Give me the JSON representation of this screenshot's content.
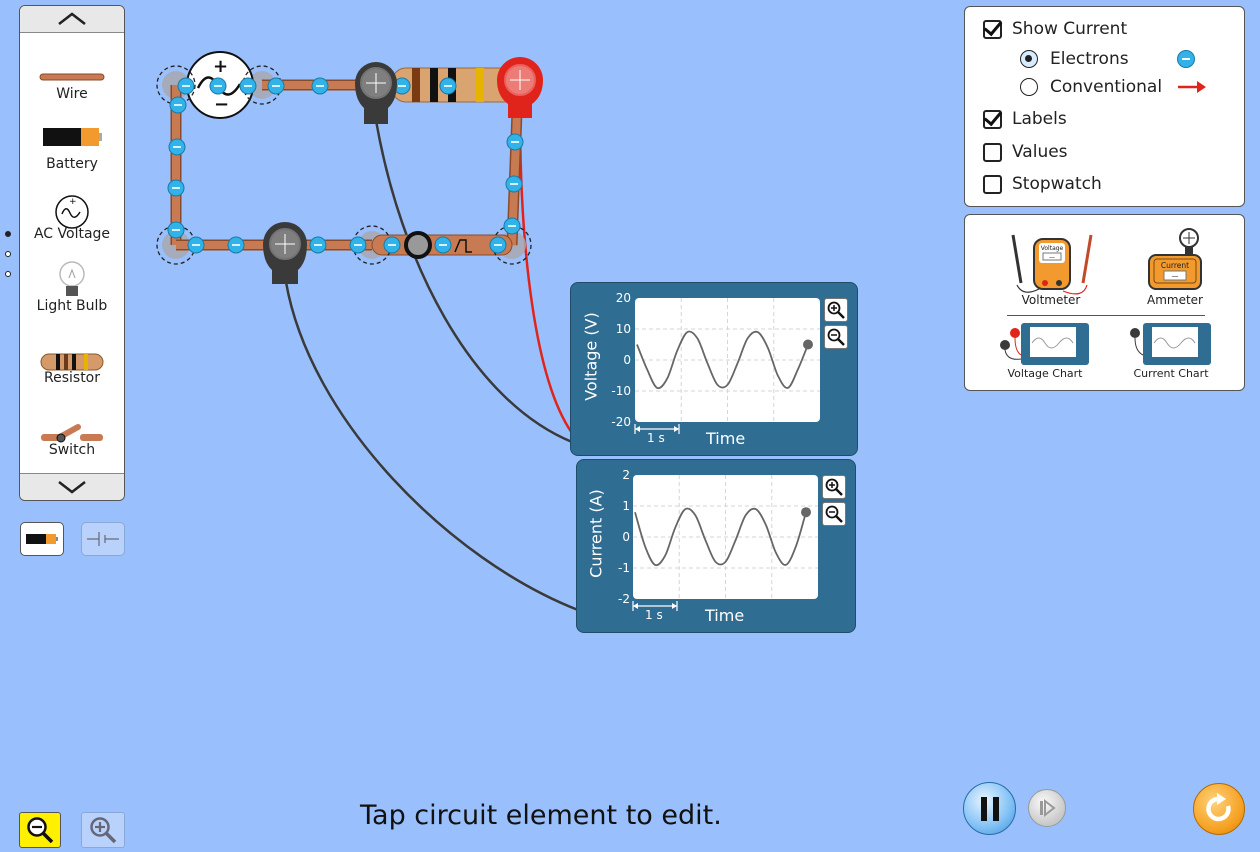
{
  "toolbox": {
    "items": [
      {
        "label": "Wire",
        "icon": "wire-icon"
      },
      {
        "label": "Battery",
        "icon": "battery-icon"
      },
      {
        "label": "AC Voltage",
        "icon": "ac-voltage-icon"
      },
      {
        "label": "Light Bulb",
        "icon": "light-bulb-icon"
      },
      {
        "label": "Resistor",
        "icon": "resistor-icon"
      },
      {
        "label": "Switch",
        "icon": "switch-icon"
      }
    ],
    "page": 1,
    "page_count": 3
  },
  "controls": {
    "show_current": {
      "label": "Show Current",
      "checked": true
    },
    "electrons": {
      "label": "Electrons",
      "selected": true
    },
    "conventional": {
      "label": "Conventional",
      "selected": false
    },
    "labels": {
      "label": "Labels",
      "checked": true
    },
    "values": {
      "label": "Values",
      "checked": false
    },
    "stopwatch": {
      "label": "Stopwatch",
      "checked": false
    }
  },
  "sensors": {
    "voltmeter": "Voltmeter",
    "ammeter": "Ammeter",
    "voltage_chart": "Voltage Chart",
    "current_chart": "Current Chart",
    "voltmeter_badge": "Voltage",
    "ammeter_badge": "Current",
    "meter_dash": "—"
  },
  "voltage_chart": {
    "y_title": "Voltage (V)",
    "x_title": "Time",
    "scale_label": "1 s",
    "ticks": [
      "20",
      "10",
      "0",
      "-10",
      "-20"
    ]
  },
  "current_chart": {
    "y_title": "Current (A)",
    "x_title": "Time",
    "scale_label": "1 s",
    "ticks": [
      "2",
      "1",
      "0",
      "-1",
      "-2"
    ]
  },
  "chart_data": [
    {
      "type": "line",
      "ylabel": "Voltage (V)",
      "xlabel": "Time",
      "ylim": [
        -20,
        20
      ],
      "x": [
        0.0,
        0.25,
        0.5,
        0.75,
        1.0,
        1.25,
        1.5,
        1.75,
        2.0,
        2.25,
        2.5,
        2.75,
        3.0,
        3.25,
        3.5,
        3.75,
        4.0,
        4.25
      ],
      "series": [
        {
          "values": [
            5,
            -3,
            -9,
            -6,
            3,
            9,
            7,
            -1,
            -8,
            -8,
            -1,
            7,
            9,
            4,
            -5,
            -9,
            -3,
            5
          ]
        }
      ]
    },
    {
      "type": "line",
      "ylabel": "Current (A)",
      "xlabel": "Time",
      "ylim": [
        -2,
        2
      ],
      "x": [
        0.0,
        0.25,
        0.5,
        0.75,
        1.0,
        1.25,
        1.5,
        1.75,
        2.0,
        2.25,
        2.5,
        2.75,
        3.0,
        3.25,
        3.5,
        3.75,
        4.0,
        4.25
      ],
      "series": [
        {
          "values": [
            0.8,
            -0.3,
            -0.9,
            -0.6,
            0.3,
            0.9,
            0.7,
            -0.1,
            -0.8,
            -0.8,
            -0.1,
            0.7,
            0.9,
            0.4,
            -0.5,
            -0.9,
            -0.3,
            0.8
          ]
        }
      ]
    }
  ],
  "status": {
    "text": "Tap circuit element to edit."
  },
  "colors": {
    "background": "#99c0fd",
    "chart_panel": "#2f6d93",
    "wire": "#c87a52",
    "electron": "#31b2e8",
    "zoom_out_active": "#fff000"
  }
}
